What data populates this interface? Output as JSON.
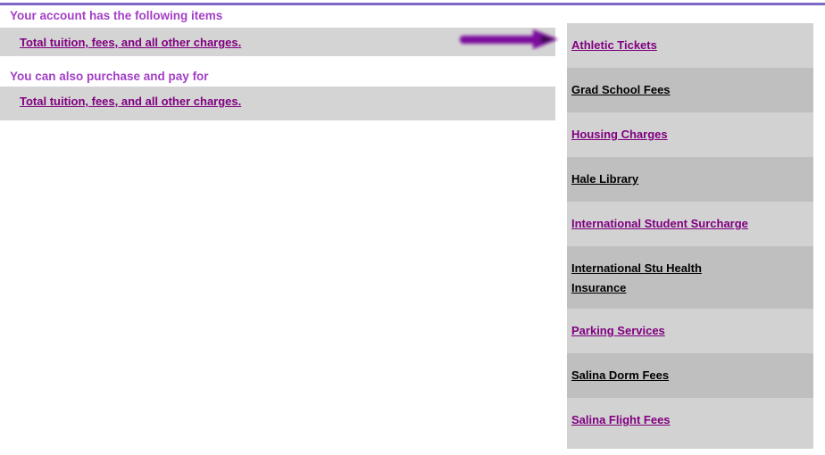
{
  "page": {
    "top_rule_color": "#7b68c8",
    "background": "#ffffff"
  },
  "left_panel": {
    "sections": [
      {
        "heading": "Your account has the following items",
        "item_label": "Total tuition, fees, and all other charges."
      },
      {
        "heading": "You can also purchase and pay for",
        "item_label": "Total tuition, fees, and all other charges."
      }
    ],
    "heading_color": "#a33fc6",
    "link_color": "#800080",
    "band_color": "#d4d4d4"
  },
  "annotation": {
    "type": "arrow",
    "direction": "right",
    "color": "#7b0f9e",
    "points_to": "Athletic Tickets"
  },
  "sidebar": {
    "row_colors": {
      "light": "#d2d2d2",
      "dark": "#bfbfbf"
    },
    "items": [
      {
        "label": "Athletic Tickets",
        "color": "purple",
        "shade": "light"
      },
      {
        "label": "Grad School Fees",
        "color": "black",
        "shade": "dark"
      },
      {
        "label": "Housing Charges",
        "color": "purple",
        "shade": "light"
      },
      {
        "label": "Hale Library",
        "color": "black",
        "shade": "dark"
      },
      {
        "label": "International Student Surcharge",
        "color": "purple",
        "shade": "light"
      },
      {
        "label": "International Stu Health",
        "label_line2": "Insurance",
        "color": "black",
        "shade": "dark"
      },
      {
        "label": "Parking Services",
        "color": "purple",
        "shade": "light"
      },
      {
        "label": "Salina Dorm Fees",
        "color": "black",
        "shade": "dark"
      },
      {
        "label": "Salina Flight Fees",
        "color": "purple",
        "shade": "light"
      }
    ]
  }
}
